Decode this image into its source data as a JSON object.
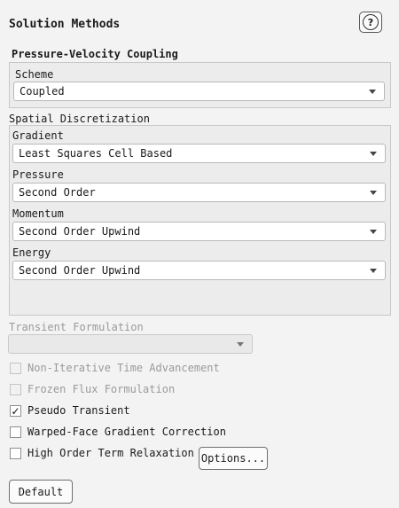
{
  "panel": {
    "title": "Solution Methods",
    "help_icon_glyph": "?"
  },
  "pv_coupling": {
    "title": "Pressure-Velocity Coupling",
    "scheme_label": "Scheme",
    "scheme_value": "Coupled"
  },
  "spatial": {
    "title": "Spatial Discretization",
    "gradient_label": "Gradient",
    "gradient_value": "Least Squares Cell Based",
    "pressure_label": "Pressure",
    "pressure_value": "Second Order",
    "momentum_label": "Momentum",
    "momentum_value": "Second Order Upwind",
    "energy_label": "Energy",
    "energy_value": "Second Order Upwind"
  },
  "transient": {
    "label": "Transient Formulation",
    "value": ""
  },
  "options": {
    "non_iterative": {
      "label": "Non-Iterative Time Advancement",
      "checked": false,
      "enabled": false
    },
    "frozen_flux": {
      "label": "Frozen Flux Formulation",
      "checked": false,
      "enabled": false
    },
    "pseudo_transient": {
      "label": "Pseudo Transient",
      "checked": true,
      "enabled": true,
      "check_glyph": "✓"
    },
    "warped_face": {
      "label": "Warped-Face Gradient Correction",
      "checked": false,
      "enabled": true
    },
    "high_order": {
      "label": "High Order Term Relaxation",
      "checked": false,
      "enabled": true
    }
  },
  "buttons": {
    "options_label": "Options...",
    "default_label": "Default"
  }
}
